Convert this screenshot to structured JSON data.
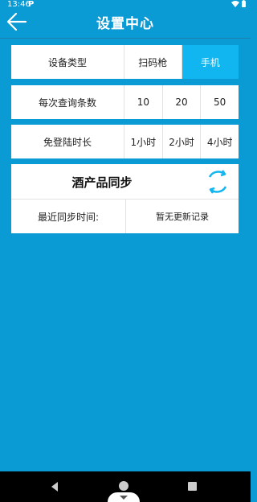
{
  "status_bar": {
    "time": "13:46",
    "p_icon": "P"
  },
  "header": {
    "title": "设置中心"
  },
  "device_type": {
    "label": "设备类型",
    "options": [
      "扫码枪",
      "手机"
    ],
    "selected": "手机"
  },
  "query_count": {
    "label": "每次查询条数",
    "options": [
      "10",
      "20",
      "50"
    ]
  },
  "login_free": {
    "label": "免登陆时长",
    "options": [
      "1小时",
      "2小时",
      "4小时"
    ]
  },
  "sync": {
    "title": "酒产品同步",
    "last_label": "最近同步时间:",
    "last_value": "暂无更新记录"
  },
  "colors": {
    "background": "#0a9ad4",
    "accent": "#11b6f0",
    "card": "#ffffff"
  }
}
